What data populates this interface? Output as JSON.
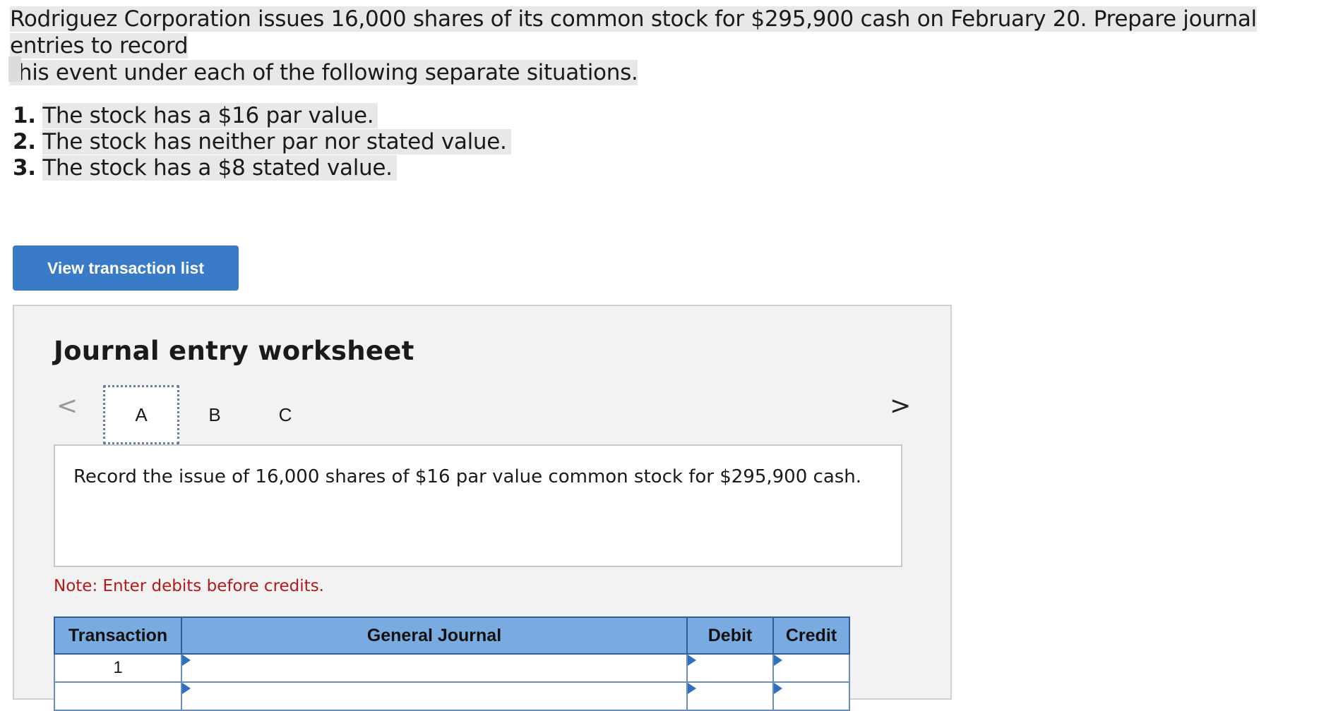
{
  "problem": {
    "line1": "Rodriguez Corporation issues 16,000 shares of its common stock for $295,900 cash on February 20. Prepare journal entries to record",
    "line2": "this event under each of the following separate situations."
  },
  "requirements": [
    {
      "num": "1.",
      "text": "The stock has a $16 par value."
    },
    {
      "num": "2.",
      "text": "The stock has neither par nor stated value."
    },
    {
      "num": "3.",
      "text": "The stock has a $8 stated value."
    }
  ],
  "view_button_label": "View transaction list",
  "worksheet": {
    "title": "Journal entry worksheet",
    "prev_arrow": "<",
    "next_arrow": ">",
    "tabs": [
      "A",
      "B",
      "C"
    ],
    "active_tab": "A",
    "instruction": "Record the issue of 16,000 shares of $16 par value common stock for $295,900 cash.",
    "note": "Note: Enter debits before credits.",
    "table": {
      "headers": [
        "Transaction",
        "General Journal",
        "Debit",
        "Credit"
      ],
      "rows": [
        {
          "transaction": "1",
          "general_journal": "",
          "debit": "",
          "credit": ""
        },
        {
          "transaction": "",
          "general_journal": "",
          "debit": "",
          "credit": ""
        }
      ]
    }
  },
  "colors": {
    "button_bg": "#3a7bc8",
    "table_header_bg": "#7aabe0",
    "note_text": "#b21a1a",
    "highlight": "#e8e8e8"
  }
}
